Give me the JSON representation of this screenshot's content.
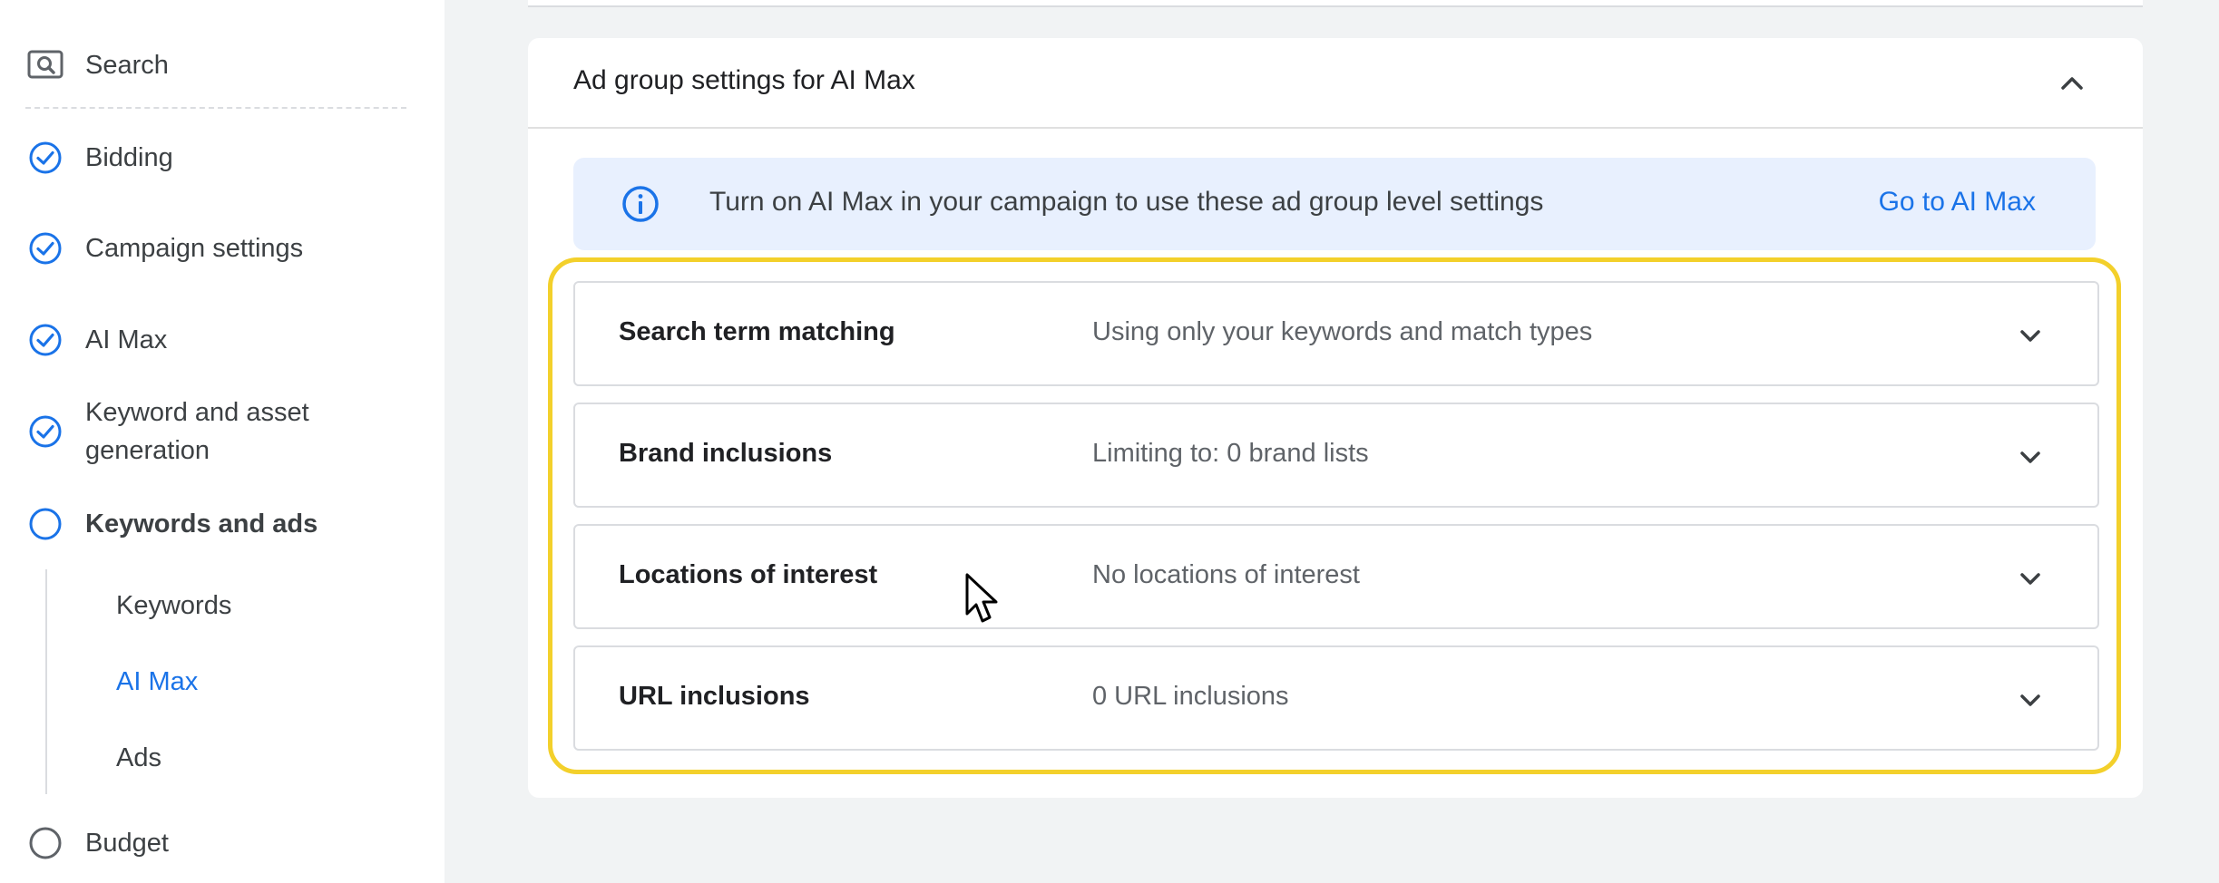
{
  "sidebar": {
    "search": {
      "label": "Search",
      "icon": "search-icon"
    },
    "steps": [
      {
        "label": "Bidding",
        "status": "complete"
      },
      {
        "label": "Campaign settings",
        "status": "complete"
      },
      {
        "label": "AI Max",
        "status": "complete"
      },
      {
        "label": "Keyword and asset generation",
        "status": "complete"
      },
      {
        "label": "Keywords and ads",
        "status": "in-progress"
      }
    ],
    "sub_items": [
      {
        "label": "Keywords",
        "active": false
      },
      {
        "label": "AI Max",
        "active": true
      },
      {
        "label": "Ads",
        "active": false
      }
    ],
    "budget": {
      "label": "Budget",
      "status": "incomplete"
    }
  },
  "card": {
    "title": "Ad group settings for AI Max",
    "banner": {
      "text": "Turn on AI Max in your campaign to use these ad group level settings",
      "link": "Go to AI Max",
      "icon": "info-icon"
    },
    "rows": [
      {
        "label": "Search term matching",
        "value": "Using only your keywords and match types"
      },
      {
        "label": "Brand inclusions",
        "value": "Limiting to: 0 brand lists"
      },
      {
        "label": "Locations of interest",
        "value": "No locations of interest"
      },
      {
        "label": "URL inclusions",
        "value": "0 URL inclusions"
      }
    ]
  },
  "colors": {
    "accent": "#1a73e8",
    "highlight": "#f3d02b",
    "banner_bg": "#e8f0fe"
  }
}
